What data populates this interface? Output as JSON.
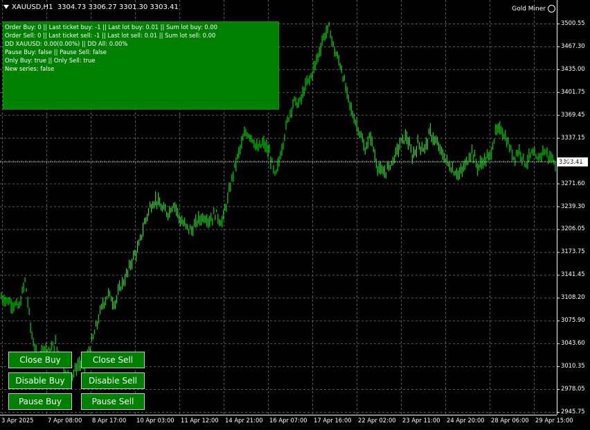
{
  "header": {
    "symbol": "XAUUSD,H1",
    "ohlc": "3304.73 3306.27 3301.30 3303.41"
  },
  "brand": {
    "label": "Gold Miner"
  },
  "info_panel": {
    "lines": [
      "Order Buy: 0 || Last ticket buy: -1 || Last lot buy: 0.01 || Sum lot buy: 0.00",
      "Order Sell: 0 || Last ticket sell: -1 || Last lot sell: 0.01 || Sum lot sell: 0.00",
      "DD XAUUSD: 0.00(0.00%) || DD All: 0.00%",
      "Pause Buy: false || Pause Sell: false",
      "Only Buy: true || Only Sell: true",
      "New series: false"
    ],
    "bg_color": "#008000"
  },
  "buttons": {
    "close_buy": "Close Buy",
    "close_sell": "Close Sell",
    "disable_buy": "Disable Buy",
    "disable_sell": "Disable Sell",
    "pause_buy": "Pause Buy",
    "pause_sell": "Pause Sell"
  },
  "chart_data": {
    "type": "bar",
    "series_color": "#00ff00",
    "background": "#000000",
    "grid": true,
    "current_price": "3303.41",
    "ylim": [
      2945.75,
      3500.55
    ],
    "price_ticks": [
      "3500.55",
      "3467.30",
      "3435.00",
      "3401.75",
      "3369.45",
      "3337.15",
      "3303.90",
      "3271.60",
      "3239.30",
      "3206.05",
      "3173.75",
      "3141.45",
      "3108.20",
      "3075.90",
      "3043.60",
      "3010.35",
      "2978.05",
      "2945.75"
    ],
    "time_ticks": [
      "3 Apr 2025",
      "7 Apr 08:00",
      "8 Apr 17:00",
      "10 Apr 03:00",
      "11 Apr 12:00",
      "14 Apr 21:00",
      "16 Apr 07:00",
      "17 Apr 16:00",
      "22 Apr 02:00",
      "23 Apr 11:00",
      "24 Apr 20:00",
      "28 Apr 06:00",
      "29 Apr 15:00"
    ],
    "close_path": [
      3110,
      3105,
      3100,
      3095,
      3135,
      3060,
      3020,
      3040,
      3030,
      3045,
      3020,
      2995,
      3000,
      3015,
      3010,
      3040,
      3070,
      3100,
      3115,
      3100,
      3125,
      3140,
      3165,
      3180,
      3215,
      3240,
      3250,
      3235,
      3230,
      3245,
      3220,
      3210,
      3205,
      3220,
      3225,
      3220,
      3230,
      3215,
      3250,
      3290,
      3320,
      3345,
      3340,
      3320,
      3330,
      3315,
      3280,
      3320,
      3360,
      3390,
      3385,
      3410,
      3425,
      3450,
      3480,
      3495,
      3460,
      3440,
      3400,
      3370,
      3350,
      3320,
      3340,
      3300,
      3285,
      3295,
      3310,
      3330,
      3340,
      3310,
      3330,
      3320,
      3345,
      3330,
      3315,
      3300,
      3290,
      3285,
      3300,
      3320,
      3295,
      3305,
      3310,
      3345,
      3350,
      3330,
      3310,
      3320,
      3300,
      3315,
      3305,
      3320,
      3310,
      3303
    ]
  }
}
